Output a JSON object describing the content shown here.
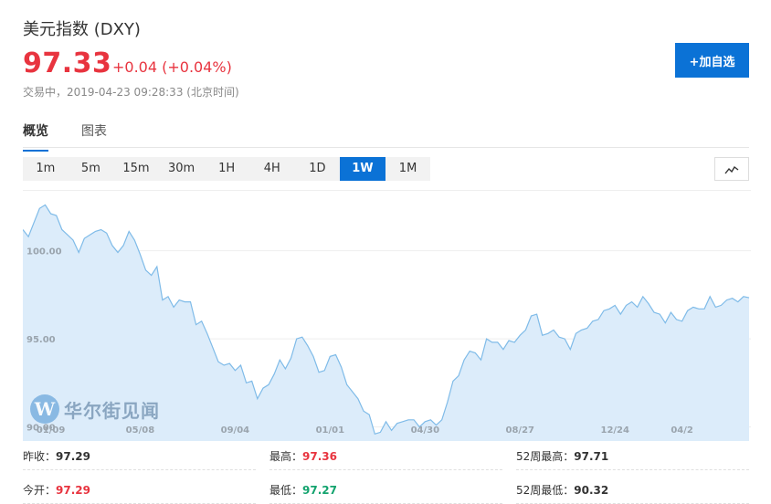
{
  "header": {
    "title": "美元指数 (DXY)",
    "price": "97.33",
    "change": "+0.04 (+0.04%)",
    "status": "交易中，2019-04-23 09:28:33 (北京时间)",
    "add_button": "+加自选"
  },
  "tabs": [
    {
      "label": "概览",
      "active": true
    },
    {
      "label": "图表",
      "active": false
    }
  ],
  "ranges": [
    {
      "label": "1m",
      "active": false
    },
    {
      "label": "5m",
      "active": false
    },
    {
      "label": "15m",
      "active": false
    },
    {
      "label": "30m",
      "active": false
    },
    {
      "label": "1H",
      "active": false
    },
    {
      "label": "4H",
      "active": false
    },
    {
      "label": "1D",
      "active": false
    },
    {
      "label": "1W",
      "active": true
    },
    {
      "label": "1M",
      "active": false
    }
  ],
  "chart_type_icon": "line-chart-icon",
  "watermark": "华尔街见闻",
  "chart_data": {
    "type": "area",
    "ylim": [
      89.2,
      103.4
    ],
    "y_ticks": [
      {
        "value": 100,
        "label": "100.00"
      },
      {
        "value": 95,
        "label": "95.00"
      },
      {
        "value": 90,
        "label": "90.00"
      }
    ],
    "x_ticks": [
      {
        "index": 5,
        "label": "01/09"
      },
      {
        "index": 21,
        "label": "05/08"
      },
      {
        "index": 38,
        "label": "09/04"
      },
      {
        "index": 55,
        "label": "01/01"
      },
      {
        "index": 72,
        "label": "04/30"
      },
      {
        "index": 89,
        "label": "08/27"
      },
      {
        "index": 106,
        "label": "12/24"
      },
      {
        "index": 120,
        "label": "04/2"
      }
    ],
    "values": [
      101.2,
      100.8,
      101.6,
      102.4,
      102.6,
      102.1,
      102.0,
      101.2,
      100.9,
      100.6,
      99.9,
      100.7,
      100.9,
      101.1,
      101.2,
      101.0,
      100.3,
      99.9,
      100.3,
      101.1,
      100.6,
      99.8,
      98.9,
      98.6,
      99.1,
      97.2,
      97.4,
      96.8,
      97.2,
      97.1,
      97.1,
      95.8,
      96.0,
      95.3,
      94.5,
      93.7,
      93.5,
      93.6,
      93.2,
      93.5,
      92.5,
      92.6,
      91.6,
      92.2,
      92.4,
      93.0,
      93.8,
      93.3,
      93.9,
      95.0,
      95.1,
      94.6,
      94.0,
      93.1,
      93.2,
      94.0,
      94.1,
      93.4,
      92.4,
      92.0,
      91.6,
      90.9,
      90.7,
      89.6,
      89.7,
      90.3,
      89.8,
      90.2,
      90.3,
      90.4,
      90.4,
      90.0,
      90.3,
      90.4,
      90.1,
      90.4,
      91.4,
      92.6,
      92.9,
      93.8,
      94.3,
      94.2,
      93.8,
      95.0,
      94.8,
      94.8,
      94.4,
      94.9,
      94.8,
      95.2,
      95.5,
      96.3,
      96.4,
      95.2,
      95.3,
      95.5,
      95.1,
      95.0,
      94.4,
      95.3,
      95.5,
      95.6,
      96.0,
      96.1,
      96.6,
      96.7,
      96.9,
      96.4,
      96.9,
      97.1,
      96.8,
      97.4,
      97.0,
      96.5,
      96.4,
      95.9,
      96.5,
      96.1,
      96.0,
      96.6,
      96.8,
      96.7,
      96.7,
      97.4,
      96.8,
      96.9,
      97.2,
      97.3,
      97.1,
      97.4,
      97.33
    ]
  },
  "stats": [
    {
      "label": "昨收：",
      "value": "97.29",
      "color": "#333333"
    },
    {
      "label": "最高：",
      "value": "97.36",
      "color": "#e8343f"
    },
    {
      "label": "52周最高：",
      "value": "97.71",
      "color": "#333333"
    },
    {
      "label": "今开：",
      "value": "97.29",
      "color": "#e8343f"
    },
    {
      "label": "最低：",
      "value": "97.27",
      "color": "#13a36e"
    },
    {
      "label": "52周最低：",
      "value": "90.32",
      "color": "#333333"
    }
  ],
  "colors": {
    "accent": "#0b72d6",
    "up": "#e8343f",
    "down": "#13a36e",
    "line": "#7fbbe8",
    "fill": "#dcecfa"
  }
}
